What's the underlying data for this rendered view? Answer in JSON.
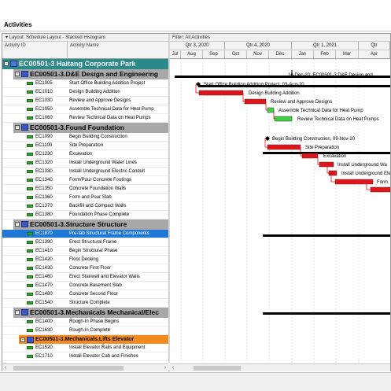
{
  "panel": {
    "title": "Activities"
  },
  "layout_bar": {
    "label": "Layout: Schedule Layout - Stacked Histogram"
  },
  "filter_bar": {
    "label": "Filter: All Activities"
  },
  "columns": {
    "activity_id": "Activity ID",
    "activity_name": "Activity Name"
  },
  "timescale": {
    "quarters": [
      "Qtr 3, 2020",
      "Qtr 4, 2020",
      "Qtr 1, 2021",
      "Qtr"
    ],
    "months": [
      "Jul",
      "Aug",
      "Sep",
      "Oct",
      "Nov",
      "Dec",
      "Jan",
      "Feb",
      "Mar",
      "Apr"
    ]
  },
  "rows": [
    {
      "type": "wbs1",
      "text": "EC00501-3  Haitang Corporate Park"
    },
    {
      "type": "wbs2",
      "text": "EC00501-3.D&E  Design and Engineering"
    },
    {
      "type": "act",
      "id": "EC1005",
      "name": "Start Office Building Addition Project"
    },
    {
      "type": "act",
      "id": "EC1010",
      "name": "Design Building Addition"
    },
    {
      "type": "act",
      "id": "EC1030",
      "name": "Review and Approve Designs"
    },
    {
      "type": "act",
      "id": "EC1050",
      "name": "Assemble Technical Data for Heat Pump"
    },
    {
      "type": "act",
      "id": "EC1060",
      "name": "Review Technical Data on Heat Pumps"
    },
    {
      "type": "wbs2",
      "text": "EC00501-3.Found  Foundation"
    },
    {
      "type": "act",
      "id": "EC1090",
      "name": "Begin Building Construction"
    },
    {
      "type": "act",
      "id": "EC1100",
      "name": "Site Preparation"
    },
    {
      "type": "act",
      "id": "EC1230",
      "name": "Excavation"
    },
    {
      "type": "act",
      "id": "EC1320",
      "name": "Install Underground Water Lines"
    },
    {
      "type": "act",
      "id": "EC1330",
      "name": "Install Underground Electric Conduit"
    },
    {
      "type": "act",
      "id": "EC1340",
      "name": "Form/Pour Concrete Footings"
    },
    {
      "type": "act",
      "id": "EC1350",
      "name": "Concrete Foundation Walls"
    },
    {
      "type": "act",
      "id": "EC1360",
      "name": "Form and Pour Slab"
    },
    {
      "type": "act",
      "id": "EC1370",
      "name": "Backfill and Compact Walls"
    },
    {
      "type": "act",
      "id": "EC1380",
      "name": "Foundation Phase Complete"
    },
    {
      "type": "wbs2",
      "text": "EC00501-3.Structure  Structure"
    },
    {
      "type": "act",
      "id": "EC1870",
      "name": "Pre-fab Structural Frame Components",
      "selected": true
    },
    {
      "type": "act",
      "id": "EC1390",
      "name": "Erect Structural Frame"
    },
    {
      "type": "act",
      "id": "EC1410",
      "name": "Begin Structural Phase"
    },
    {
      "type": "act",
      "id": "EC1420",
      "name": "Floor Decking"
    },
    {
      "type": "act",
      "id": "EC1430",
      "name": "Concrete First Floor"
    },
    {
      "type": "act",
      "id": "EC1460",
      "name": "Erect Stairwell and Elevator Walls"
    },
    {
      "type": "act",
      "id": "EC1470",
      "name": "Concrete Basement Slab"
    },
    {
      "type": "act",
      "id": "EC1480",
      "name": "Concrete Second Floor"
    },
    {
      "type": "act",
      "id": "EC1540",
      "name": "Structure Complete"
    },
    {
      "type": "wbs2",
      "text": "EC00501-3.Mechanicals  Mechanical/Elec"
    },
    {
      "type": "act",
      "id": "EC1400",
      "name": "Rough-In Phase Begins"
    },
    {
      "type": "act",
      "id": "EC1630",
      "name": "Rough-In Complete"
    },
    {
      "type": "wbs3",
      "text": "EC00501-3.Mechanicals.Lifts  Elevator"
    },
    {
      "type": "act",
      "id": "EC1520",
      "name": "Install Elevator Rails and Equipment"
    },
    {
      "type": "act",
      "id": "EC1710",
      "name": "Install Elevator Cab and Finishes"
    }
  ],
  "gantt_labels": {
    "wbs_de": "16-Dec-20, EC00501-3.D&E  Design and",
    "start_milestone": "Start Office Building Addition Project, 03-Aug-20",
    "design": "Design Building Addition",
    "review": "Review and Approve Designs",
    "assemble": "Assemble Technical Data for Heat Pump",
    "review_hp": "Review Technical Data on Heat Pumps",
    "begin_const": "Begin Building Construction, 09-Nov-20",
    "site_prep": "Site Preparation",
    "excavation": "Excavation",
    "water": "Install Underground Wa",
    "electric": "Install Underground Elect",
    "form": "Form"
  },
  "colors": {
    "wbs1": "#2a8a8a",
    "wbs2": "#a8a8a8",
    "wbs3": "#f28a1e",
    "critical_bar": "#e0141a",
    "normal_bar": "#3fd13f",
    "selection": "#1f78d6"
  }
}
